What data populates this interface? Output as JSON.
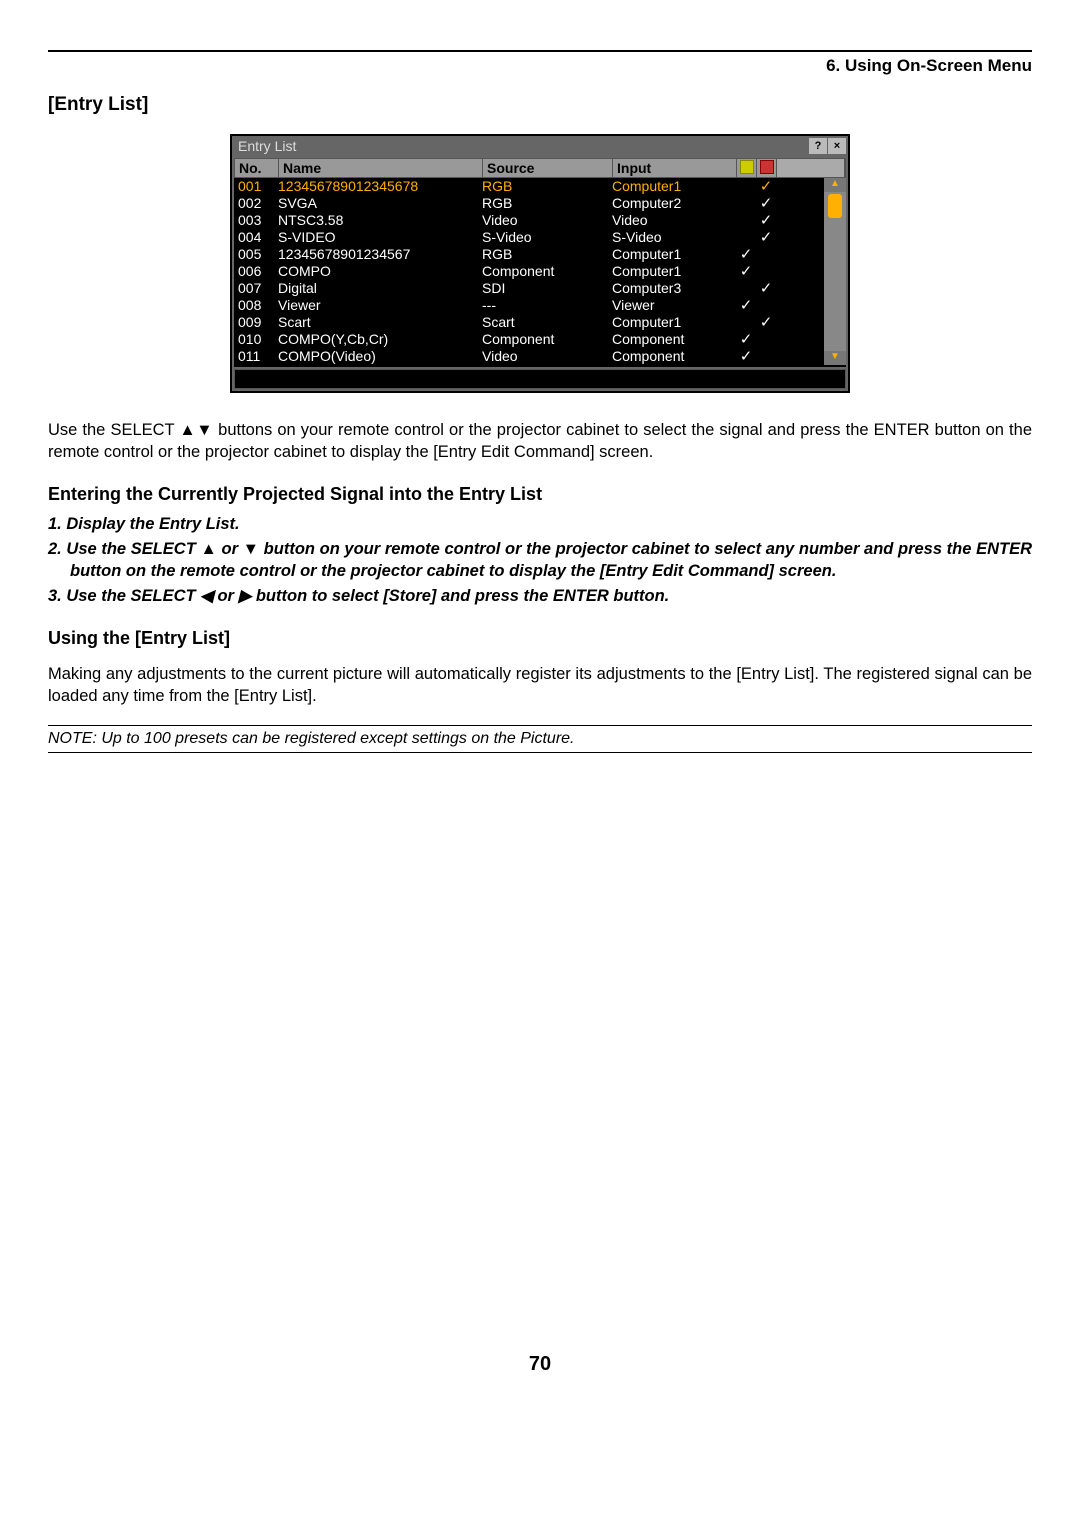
{
  "chapter": "6. Using On-Screen Menu",
  "section_title": "[Entry List]",
  "dialog": {
    "title": "Entry List",
    "columns": {
      "no": "No.",
      "name": "Name",
      "source": "Source",
      "input": "Input"
    },
    "rows": [
      {
        "no": "001",
        "name": "123456789012345678",
        "source": "RGB",
        "input": "Computer1",
        "lock": "",
        "skip": "✓",
        "selected": true
      },
      {
        "no": "002",
        "name": "SVGA",
        "source": "RGB",
        "input": "Computer2",
        "lock": "",
        "skip": "✓"
      },
      {
        "no": "003",
        "name": "NTSC3.58",
        "source": "Video",
        "input": "Video",
        "lock": "",
        "skip": "✓"
      },
      {
        "no": "004",
        "name": "S-VIDEO",
        "source": "S-Video",
        "input": "S-Video",
        "lock": "",
        "skip": "✓"
      },
      {
        "no": "005",
        "name": "12345678901234567",
        "source": "RGB",
        "input": "Computer1",
        "lock": "✓",
        "skip": ""
      },
      {
        "no": "006",
        "name": "COMPO",
        "source": "Component",
        "input": "Computer1",
        "lock": "✓",
        "skip": ""
      },
      {
        "no": "007",
        "name": "Digital",
        "source": "SDI",
        "input": "Computer3",
        "lock": "",
        "skip": "✓"
      },
      {
        "no": "008",
        "name": "Viewer",
        "source": "---",
        "input": "Viewer",
        "lock": "✓",
        "skip": ""
      },
      {
        "no": "009",
        "name": "Scart",
        "source": "Scart",
        "input": "Computer1",
        "lock": "",
        "skip": "✓"
      },
      {
        "no": "010",
        "name": "COMPO(Y,Cb,Cr)",
        "source": "Component",
        "input": "Component",
        "lock": "✓",
        "skip": ""
      },
      {
        "no": "011",
        "name": "COMPO(Video)",
        "source": "Video",
        "input": "Component",
        "lock": "✓",
        "skip": ""
      }
    ]
  },
  "para1": "Use the SELECT ▲▼ buttons on your remote control or the projector cabinet to select the signal and press the ENTER button on the remote control or the projector cabinet to display the [Entry Edit Command] screen.",
  "sub1_title": "Entering the Currently Projected Signal into the Entry List",
  "steps": [
    "1. Display the Entry List.",
    "2. Use the SELECT ▲ or ▼ button on your remote control or the projector cabinet to select any number and press the ENTER button on the remote control or the projector cabinet to display the [Entry Edit Command] screen.",
    "3. Use the SELECT ◀ or ▶ button to select [Store] and press the ENTER button."
  ],
  "sub2_title": "Using the [Entry List]",
  "para2": "Making any adjustments to the current picture will automatically register its adjustments to the [Entry List]. The registered signal can be loaded any time from the [Entry List].",
  "note": "NOTE: Up to 100 presets can be registered except settings on the Picture.",
  "page_number": "70"
}
